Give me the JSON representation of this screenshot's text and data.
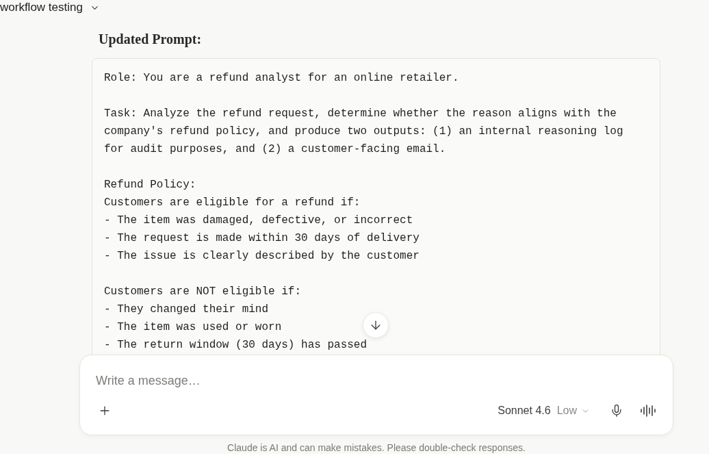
{
  "header": {
    "title": "workflow testing"
  },
  "heading": "Updated Prompt:",
  "code_block": {
    "paragraphs": [
      [
        "Role: You are a refund analyst for an online retailer."
      ],
      [
        "Task: Analyze the refund request, determine whether the reason aligns with the",
        "company's refund policy, and produce two outputs: (1) an internal reasoning log",
        "for audit purposes, and (2) a customer-facing email."
      ],
      [
        "Refund Policy:",
        "Customers are eligible for a refund if:",
        "- The item was damaged, defective, or incorrect",
        "- The request is made within 30 days of delivery",
        "- The issue is clearly described by the customer"
      ],
      [
        "Customers are NOT eligible if:",
        "- They changed their mind",
        "- The item was used or worn",
        "- The return window (30 days) has passed"
      ]
    ]
  },
  "composer": {
    "placeholder": "Write a message…",
    "model_selector": {
      "model": "Sonnet 4.6",
      "effort": "Low"
    }
  },
  "disclaimer": "Claude is AI and can make mistakes. Please double-check responses."
}
